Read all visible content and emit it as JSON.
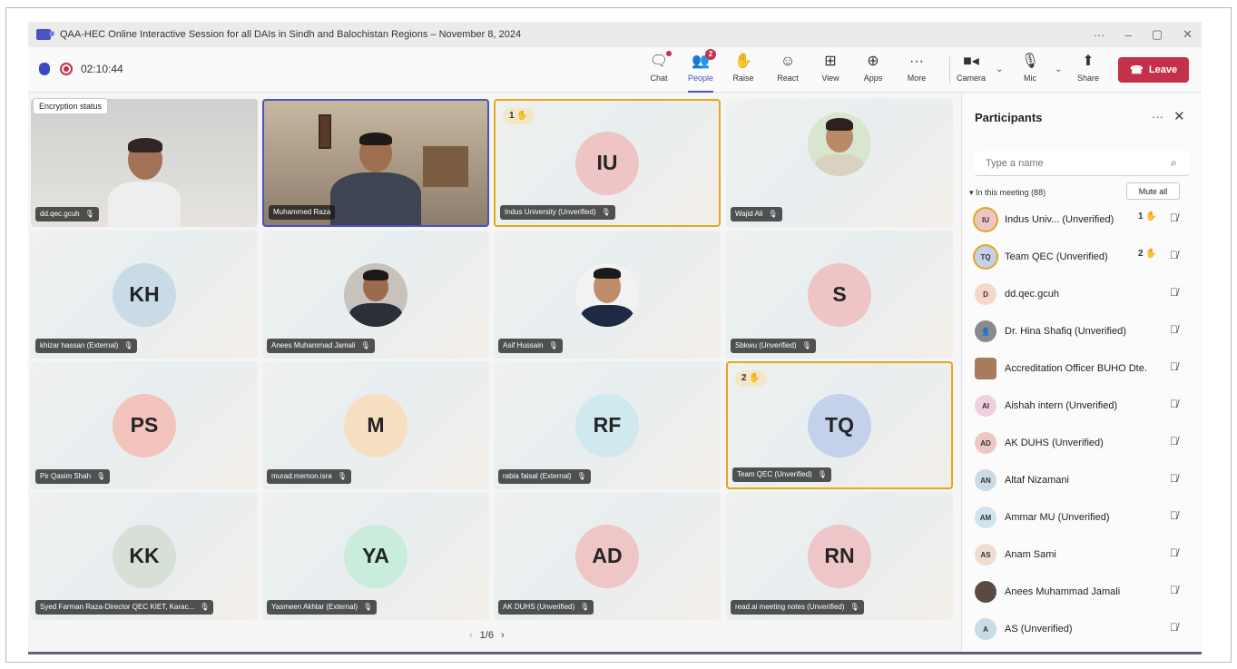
{
  "window": {
    "title": "QAA-HEC Online Interactive Session for all DAIs in Sindh and Balochistan Regions – November 8, 2024",
    "controls": [
      "···",
      "–",
      "▢",
      "✕"
    ]
  },
  "toolbar": {
    "timer": "02:10:44",
    "tooltip": "Encryption status",
    "buttons": {
      "chat": "Chat",
      "people": "People",
      "people_badge": "2",
      "raise": "Raise",
      "react": "React",
      "view": "View",
      "apps": "Apps",
      "more": "More",
      "camera": "Camera",
      "mic": "Mic",
      "share": "Share",
      "leave": "Leave"
    }
  },
  "grid": {
    "tiles": [
      {
        "name": "dd.qec.gcuh",
        "initials": "",
        "type": "photo"
      },
      {
        "name": "Muhammed Raza",
        "initials": "",
        "type": "photo"
      },
      {
        "name": "Indus University (Unverified)",
        "initials": "IU",
        "raise": "1 ✋"
      },
      {
        "name": "Wajid Ali",
        "initials": "",
        "type": "photo"
      },
      {
        "name": "khizar hassan (External)",
        "initials": "KH"
      },
      {
        "name": "Anees Muhammad Jamali",
        "initials": "",
        "type": "photo"
      },
      {
        "name": "Asif Hussain",
        "initials": "",
        "type": "photo"
      },
      {
        "name": "Sbkwu (Unverified)",
        "initials": "S"
      },
      {
        "name": "Pir Qasim Shah",
        "initials": "PS"
      },
      {
        "name": "murad.memon.isra",
        "initials": "M"
      },
      {
        "name": "rabia faisal (External)",
        "initials": "RF"
      },
      {
        "name": "Team QEC (Unverified)",
        "initials": "TQ",
        "raise": "2 ✋"
      },
      {
        "name": "Syed Farman Raza-Director QEC KIET, Karac...",
        "initials": "KK"
      },
      {
        "name": "Yasmeen Akhtar (External)",
        "initials": "YA"
      },
      {
        "name": "AK DUHS (Unverified)",
        "initials": "AD"
      },
      {
        "name": "read.ai meeting notes (Unverified)",
        "initials": "RN"
      }
    ],
    "pager": "1/6"
  },
  "participants": {
    "title": "Participants",
    "search_placeholder": "Type a name",
    "section": "In this meeting (88)",
    "mute_all": "Mute all",
    "list": [
      {
        "initials": "IU",
        "name": "Indus Univ... (Unverified)",
        "hand": "1 ✋"
      },
      {
        "initials": "TQ",
        "name": "Team QEC (Unverified)",
        "hand": "2 ✋"
      },
      {
        "initials": "D",
        "name": "dd.qec.gcuh",
        "hand": ""
      },
      {
        "initials": "",
        "name": "Dr. Hina Shafiq (Unverified)",
        "hand": ""
      },
      {
        "initials": "",
        "name": "Accreditation Officer BUHO Dte.",
        "hand": ""
      },
      {
        "initials": "AI",
        "name": "Aishah intern (Unverified)",
        "hand": ""
      },
      {
        "initials": "AD",
        "name": "AK DUHS (Unverified)",
        "hand": ""
      },
      {
        "initials": "AN",
        "name": "Altaf Nizamani",
        "hand": ""
      },
      {
        "initials": "AM",
        "name": "Ammar MU (Unverified)",
        "hand": ""
      },
      {
        "initials": "AS",
        "name": "Anam Sami",
        "hand": ""
      },
      {
        "initials": "",
        "name": "Anees Muhammad Jamali",
        "hand": ""
      },
      {
        "initials": "A",
        "name": "AS (Unverified)",
        "hand": ""
      }
    ]
  },
  "colors": {
    "accent": "#4b53bc",
    "leave": "#c4314b",
    "raised_hand": "#e1a81f"
  }
}
